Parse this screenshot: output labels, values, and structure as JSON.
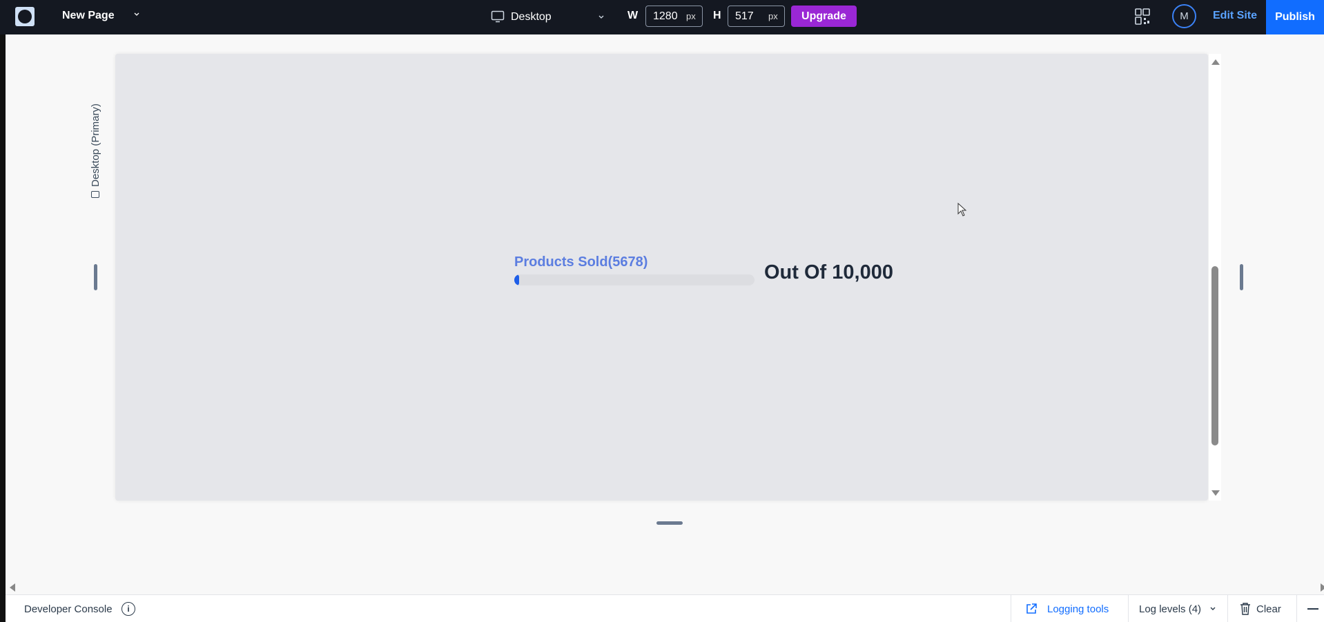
{
  "topbar": {
    "page_name": "New Page",
    "device": "Desktop",
    "width_label": "W",
    "width_value": "1280",
    "width_unit": "px",
    "height_label": "H",
    "height_value": "517",
    "height_unit": "px",
    "upgrade_label": "Upgrade",
    "avatar_initial": "M",
    "edit_site_label": "Edit Site",
    "publish_label": "Publish"
  },
  "canvas": {
    "side_label": "Desktop (Primary)",
    "progress": {
      "title": "Products Sold(5678)",
      "fill_fraction": 0.02,
      "out_of_text": "Out Of 10,000"
    }
  },
  "console": {
    "title": "Developer Console",
    "logging_tools_label": "Logging tools",
    "log_levels_label": "Log levels (4)",
    "clear_label": "Clear"
  },
  "colors": {
    "topbar_bg": "#141821",
    "upgrade": "#9a27d5",
    "publish": "#116dff",
    "progress_fill": "#1e5ee8",
    "progress_title": "#5b7de0"
  }
}
